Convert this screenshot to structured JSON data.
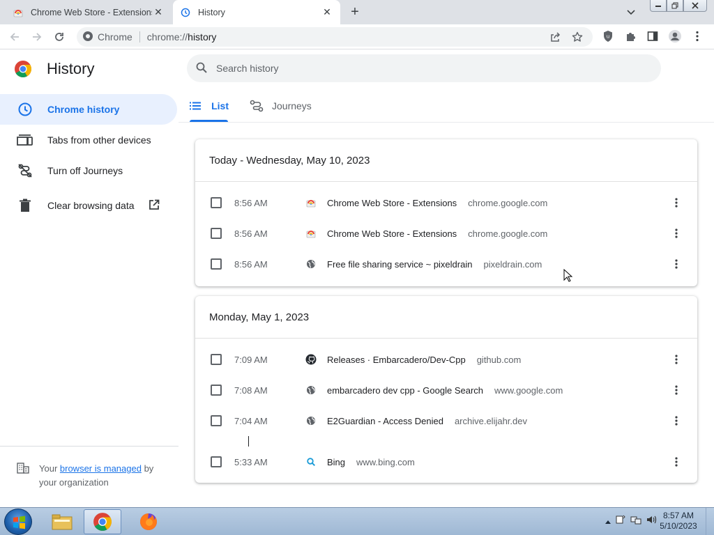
{
  "browser": {
    "tabs": [
      {
        "title": "Chrome Web Store - Extensions",
        "active": false
      },
      {
        "title": "History",
        "active": true
      }
    ],
    "new_tab_label": "+",
    "omnibox": {
      "site_label": "Chrome",
      "url_scheme": "chrome://",
      "url_host": "history"
    }
  },
  "sidebar": {
    "title": "History",
    "items": [
      {
        "label": "Chrome history",
        "icon": "clock-icon",
        "active": true
      },
      {
        "label": "Tabs from other devices",
        "icon": "devices-icon",
        "active": false
      },
      {
        "label": "Turn off Journeys",
        "icon": "journeys-off-icon",
        "active": false
      },
      {
        "label": "Clear browsing data",
        "icon": "trash-icon",
        "active": false
      }
    ],
    "managed": {
      "prefix": "Your ",
      "link": "browser is managed",
      "suffix": " by your organization"
    }
  },
  "search": {
    "placeholder": "Search history"
  },
  "view_tabs": [
    {
      "label": "List",
      "active": true
    },
    {
      "label": "Journeys",
      "active": false
    }
  ],
  "groups": [
    {
      "date": "Today - Wednesday, May 10, 2023",
      "entries": [
        {
          "time": "8:56 AM",
          "title": "Chrome Web Store - Extensions",
          "domain": "chrome.google.com",
          "icon": "webstore-icon"
        },
        {
          "time": "8:56 AM",
          "title": "Chrome Web Store - Extensions",
          "domain": "chrome.google.com",
          "icon": "webstore-icon"
        },
        {
          "time": "8:56 AM",
          "title": "Free file sharing service ~ pixeldrain",
          "domain": "pixeldrain.com",
          "icon": "globe-icon"
        }
      ]
    },
    {
      "date": "Monday, May 1, 2023",
      "entries": [
        {
          "time": "7:09 AM",
          "title": "Releases · Embarcadero/Dev-Cpp",
          "domain": "github.com",
          "icon": "github-icon"
        },
        {
          "time": "7:08 AM",
          "title": "embarcadero dev cpp - Google Search",
          "domain": "www.google.com",
          "icon": "globe-icon"
        },
        {
          "time": "7:04 AM",
          "title": "E2Guardian - Access Denied",
          "domain": "archive.elijahr.dev",
          "icon": "globe-icon"
        },
        {
          "time": "5:33 AM",
          "title": "Bing",
          "domain": "www.bing.com",
          "icon": "bing-search-icon"
        }
      ]
    }
  ],
  "taskbar": {
    "time": "8:57 AM",
    "date": "5/10/2023"
  },
  "colors": {
    "accent": "#1a73e8",
    "active_bg": "#e8f0fe"
  }
}
